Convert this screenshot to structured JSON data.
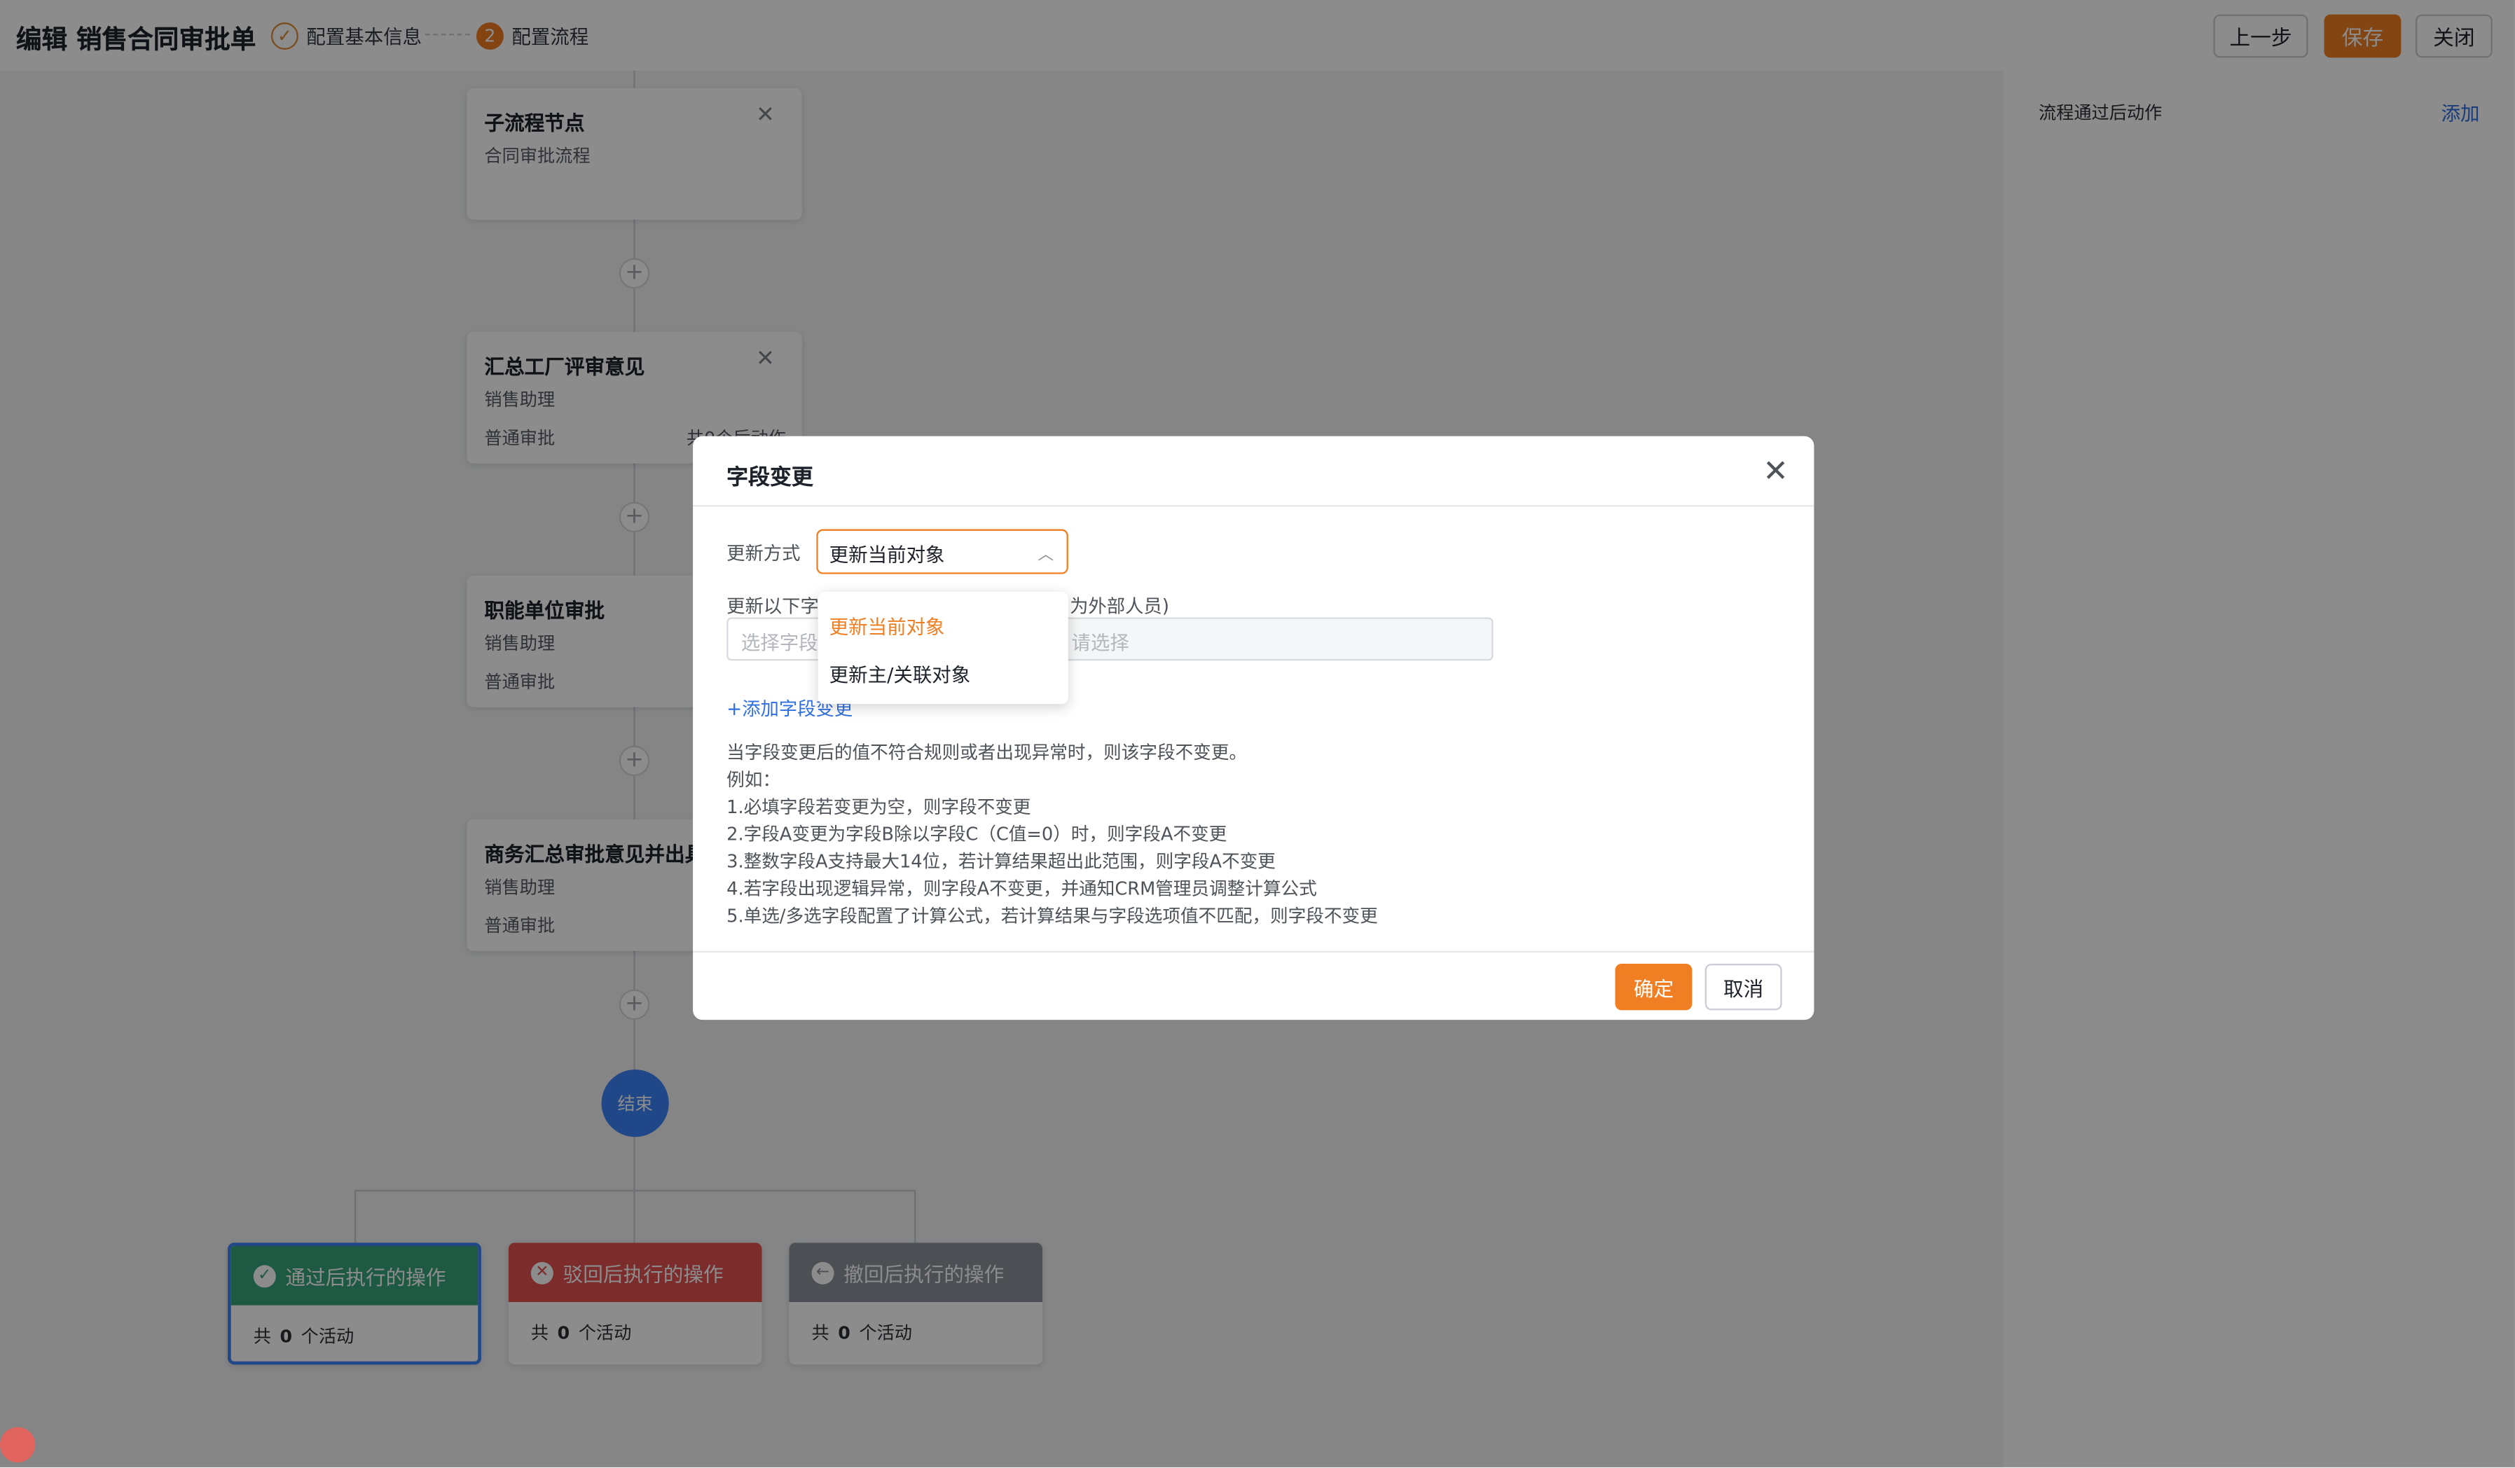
{
  "header": {
    "title": "编辑 销售合同审批单",
    "steps": [
      {
        "index": "✓",
        "label": "配置基本信息",
        "state": "done"
      },
      {
        "index": "2",
        "label": "配置流程",
        "state": "current"
      }
    ],
    "buttons": {
      "prev": "上一步",
      "save": "保存",
      "close": "关闭"
    }
  },
  "flow": {
    "nodes": [
      {
        "title": "子流程节点",
        "lines": [
          "合同审批流程"
        ],
        "right": ""
      },
      {
        "title": "汇总工厂评审意见",
        "lines": [
          "销售助理",
          "普通审批"
        ],
        "right": "共0个后动作"
      },
      {
        "title": "职能单位审批",
        "lines": [
          "销售助理",
          "普通审批"
        ],
        "right": ""
      },
      {
        "title": "商务汇总审批意见并出具",
        "lines": [
          "销售助理",
          "普通审批"
        ],
        "right": ""
      }
    ],
    "end_label": "结束",
    "actions": [
      {
        "label": "通过后执行的操作",
        "prefix": "共",
        "count": "0",
        "suffix": "个活动",
        "color": "#37a47a"
      },
      {
        "label": "驳回后执行的操作",
        "prefix": "共",
        "count": "0",
        "suffix": "个活动",
        "color": "#e0514f"
      },
      {
        "label": "撤回后执行的操作",
        "prefix": "共",
        "count": "0",
        "suffix": "个活动",
        "color": "#8a9099"
      }
    ]
  },
  "right_panel": {
    "title": "流程通过后动作",
    "add": "添加"
  },
  "dialog": {
    "title": "字段变更",
    "update_mode_label": "更新方式",
    "update_mode_value": "更新当前对象",
    "fields_label_left": "更新以下字",
    "fields_label_right": "为外部人员)",
    "field_placeholder": "选择字段",
    "value_placeholder": "请选择",
    "add_field": "+添加字段变更",
    "help_lines": [
      "当字段变更后的值不符合规则或者出现异常时，则该字段不变更。",
      "例如：",
      "1.必填字段若变更为空，则字段不变更",
      "2.字段A变更为字段B除以字段C（C值=0）时，则字段A不变更",
      "3.整数字段A支持最大14位，若计算结果超出此范围，则字段A不变更",
      "4.若字段出现逻辑异常，则字段A不变更，并通知CRM管理员调整计算公式",
      "5.单选/多选字段配置了计算公式，若计算结果与字段选项值不匹配，则字段不变更"
    ],
    "ok": "确定",
    "cancel": "取消"
  },
  "dropdown": {
    "options": [
      "更新当前对象",
      "更新主/关联对象"
    ],
    "selected": "更新当前对象"
  },
  "colors": {
    "accent": "#ef7f22",
    "link": "#2f6fde",
    "end_node": "#3b82f6"
  }
}
